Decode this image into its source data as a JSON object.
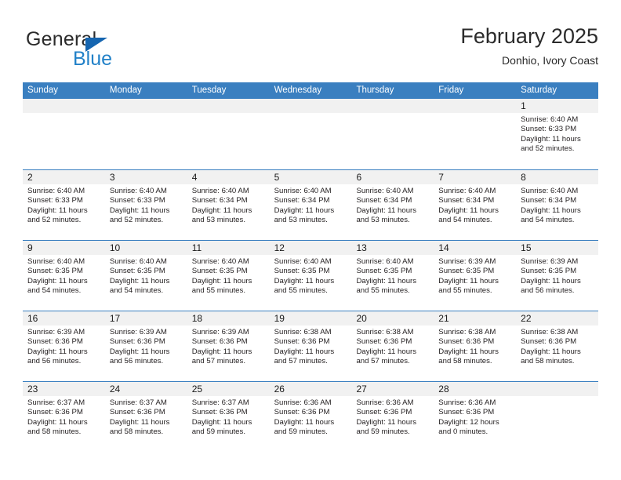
{
  "brand": {
    "name_top": "General",
    "name_bottom": "Blue",
    "accent_color": "#2281c8",
    "triangle_color": "#1565b0"
  },
  "header": {
    "title": "February 2025",
    "subtitle": "Donhio, Ivory Coast"
  },
  "calendar": {
    "header_bg": "#3a7fc0",
    "day_band_bg": "#f1f1f1",
    "weekdays": [
      "Sunday",
      "Monday",
      "Tuesday",
      "Wednesday",
      "Thursday",
      "Friday",
      "Saturday"
    ],
    "weeks": [
      [
        {
          "day": "",
          "sunrise": "",
          "sunset": "",
          "daylight": "",
          "empty": true
        },
        {
          "day": "",
          "sunrise": "",
          "sunset": "",
          "daylight": "",
          "empty": true
        },
        {
          "day": "",
          "sunrise": "",
          "sunset": "",
          "daylight": "",
          "empty": true
        },
        {
          "day": "",
          "sunrise": "",
          "sunset": "",
          "daylight": "",
          "empty": true
        },
        {
          "day": "",
          "sunrise": "",
          "sunset": "",
          "daylight": "",
          "empty": true
        },
        {
          "day": "",
          "sunrise": "",
          "sunset": "",
          "daylight": "",
          "empty": true
        },
        {
          "day": "1",
          "sunrise": "Sunrise: 6:40 AM",
          "sunset": "Sunset: 6:33 PM",
          "daylight": "Daylight: 11 hours and 52 minutes.",
          "empty": false
        }
      ],
      [
        {
          "day": "2",
          "sunrise": "Sunrise: 6:40 AM",
          "sunset": "Sunset: 6:33 PM",
          "daylight": "Daylight: 11 hours and 52 minutes.",
          "empty": false
        },
        {
          "day": "3",
          "sunrise": "Sunrise: 6:40 AM",
          "sunset": "Sunset: 6:33 PM",
          "daylight": "Daylight: 11 hours and 52 minutes.",
          "empty": false
        },
        {
          "day": "4",
          "sunrise": "Sunrise: 6:40 AM",
          "sunset": "Sunset: 6:34 PM",
          "daylight": "Daylight: 11 hours and 53 minutes.",
          "empty": false
        },
        {
          "day": "5",
          "sunrise": "Sunrise: 6:40 AM",
          "sunset": "Sunset: 6:34 PM",
          "daylight": "Daylight: 11 hours and 53 minutes.",
          "empty": false
        },
        {
          "day": "6",
          "sunrise": "Sunrise: 6:40 AM",
          "sunset": "Sunset: 6:34 PM",
          "daylight": "Daylight: 11 hours and 53 minutes.",
          "empty": false
        },
        {
          "day": "7",
          "sunrise": "Sunrise: 6:40 AM",
          "sunset": "Sunset: 6:34 PM",
          "daylight": "Daylight: 11 hours and 54 minutes.",
          "empty": false
        },
        {
          "day": "8",
          "sunrise": "Sunrise: 6:40 AM",
          "sunset": "Sunset: 6:34 PM",
          "daylight": "Daylight: 11 hours and 54 minutes.",
          "empty": false
        }
      ],
      [
        {
          "day": "9",
          "sunrise": "Sunrise: 6:40 AM",
          "sunset": "Sunset: 6:35 PM",
          "daylight": "Daylight: 11 hours and 54 minutes.",
          "empty": false
        },
        {
          "day": "10",
          "sunrise": "Sunrise: 6:40 AM",
          "sunset": "Sunset: 6:35 PM",
          "daylight": "Daylight: 11 hours and 54 minutes.",
          "empty": false
        },
        {
          "day": "11",
          "sunrise": "Sunrise: 6:40 AM",
          "sunset": "Sunset: 6:35 PM",
          "daylight": "Daylight: 11 hours and 55 minutes.",
          "empty": false
        },
        {
          "day": "12",
          "sunrise": "Sunrise: 6:40 AM",
          "sunset": "Sunset: 6:35 PM",
          "daylight": "Daylight: 11 hours and 55 minutes.",
          "empty": false
        },
        {
          "day": "13",
          "sunrise": "Sunrise: 6:40 AM",
          "sunset": "Sunset: 6:35 PM",
          "daylight": "Daylight: 11 hours and 55 minutes.",
          "empty": false
        },
        {
          "day": "14",
          "sunrise": "Sunrise: 6:39 AM",
          "sunset": "Sunset: 6:35 PM",
          "daylight": "Daylight: 11 hours and 55 minutes.",
          "empty": false
        },
        {
          "day": "15",
          "sunrise": "Sunrise: 6:39 AM",
          "sunset": "Sunset: 6:35 PM",
          "daylight": "Daylight: 11 hours and 56 minutes.",
          "empty": false
        }
      ],
      [
        {
          "day": "16",
          "sunrise": "Sunrise: 6:39 AM",
          "sunset": "Sunset: 6:36 PM",
          "daylight": "Daylight: 11 hours and 56 minutes.",
          "empty": false
        },
        {
          "day": "17",
          "sunrise": "Sunrise: 6:39 AM",
          "sunset": "Sunset: 6:36 PM",
          "daylight": "Daylight: 11 hours and 56 minutes.",
          "empty": false
        },
        {
          "day": "18",
          "sunrise": "Sunrise: 6:39 AM",
          "sunset": "Sunset: 6:36 PM",
          "daylight": "Daylight: 11 hours and 57 minutes.",
          "empty": false
        },
        {
          "day": "19",
          "sunrise": "Sunrise: 6:38 AM",
          "sunset": "Sunset: 6:36 PM",
          "daylight": "Daylight: 11 hours and 57 minutes.",
          "empty": false
        },
        {
          "day": "20",
          "sunrise": "Sunrise: 6:38 AM",
          "sunset": "Sunset: 6:36 PM",
          "daylight": "Daylight: 11 hours and 57 minutes.",
          "empty": false
        },
        {
          "day": "21",
          "sunrise": "Sunrise: 6:38 AM",
          "sunset": "Sunset: 6:36 PM",
          "daylight": "Daylight: 11 hours and 58 minutes.",
          "empty": false
        },
        {
          "day": "22",
          "sunrise": "Sunrise: 6:38 AM",
          "sunset": "Sunset: 6:36 PM",
          "daylight": "Daylight: 11 hours and 58 minutes.",
          "empty": false
        }
      ],
      [
        {
          "day": "23",
          "sunrise": "Sunrise: 6:37 AM",
          "sunset": "Sunset: 6:36 PM",
          "daylight": "Daylight: 11 hours and 58 minutes.",
          "empty": false
        },
        {
          "day": "24",
          "sunrise": "Sunrise: 6:37 AM",
          "sunset": "Sunset: 6:36 PM",
          "daylight": "Daylight: 11 hours and 58 minutes.",
          "empty": false
        },
        {
          "day": "25",
          "sunrise": "Sunrise: 6:37 AM",
          "sunset": "Sunset: 6:36 PM",
          "daylight": "Daylight: 11 hours and 59 minutes.",
          "empty": false
        },
        {
          "day": "26",
          "sunrise": "Sunrise: 6:36 AM",
          "sunset": "Sunset: 6:36 PM",
          "daylight": "Daylight: 11 hours and 59 minutes.",
          "empty": false
        },
        {
          "day": "27",
          "sunrise": "Sunrise: 6:36 AM",
          "sunset": "Sunset: 6:36 PM",
          "daylight": "Daylight: 11 hours and 59 minutes.",
          "empty": false
        },
        {
          "day": "28",
          "sunrise": "Sunrise: 6:36 AM",
          "sunset": "Sunset: 6:36 PM",
          "daylight": "Daylight: 12 hours and 0 minutes.",
          "empty": false
        },
        {
          "day": "",
          "sunrise": "",
          "sunset": "",
          "daylight": "",
          "empty": true
        }
      ]
    ]
  }
}
